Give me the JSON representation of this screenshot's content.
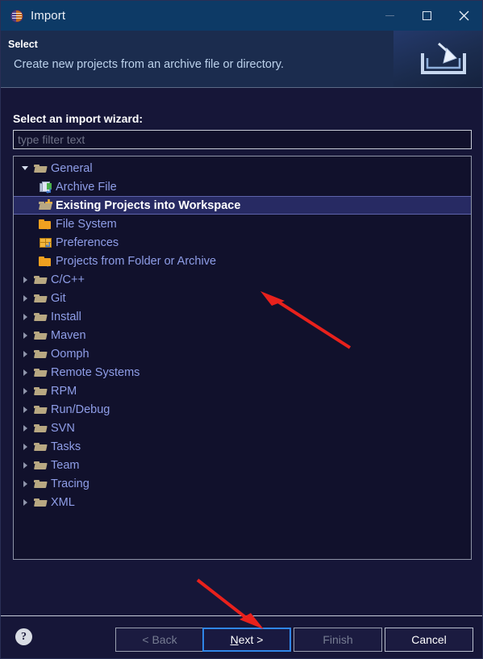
{
  "window": {
    "title": "Import",
    "app_icon": "eclipse-globe-icon",
    "controls": {
      "minimize": "minimize-icon",
      "maximize": "maximize-icon",
      "close": "close-icon"
    },
    "titlebar_color": "#0d3a66",
    "body_color": "#161638"
  },
  "header": {
    "title": "Select",
    "description": "Create new projects from an archive file or directory.",
    "graphic": "import-tray-icon",
    "banner_color": "#1b2c4e"
  },
  "main": {
    "wizard_label": "Select an import wizard:",
    "filter": {
      "placeholder": "type filter text",
      "value": ""
    },
    "tree": [
      {
        "label": "General",
        "icon": "folder-open-icon",
        "level": 0,
        "expanded": true,
        "twisty": "expanded",
        "selected": false
      },
      {
        "label": "Archive File",
        "icon": "archive-file-icon",
        "level": 1,
        "twisty": "none",
        "selected": false
      },
      {
        "label": "Existing Projects into Workspace",
        "icon": "folder-import-icon",
        "level": 1,
        "twisty": "none",
        "selected": true
      },
      {
        "label": "File System",
        "icon": "folder-filesystem-icon",
        "level": 1,
        "twisty": "none",
        "selected": false
      },
      {
        "label": "Preferences",
        "icon": "preferences-grid-icon",
        "level": 1,
        "twisty": "none",
        "selected": false
      },
      {
        "label": "Projects from Folder or Archive",
        "icon": "folder-filesystem-icon",
        "level": 1,
        "twisty": "none",
        "selected": false
      },
      {
        "label": "C/C++",
        "icon": "folder-open-icon",
        "level": 0,
        "twisty": "collapsed",
        "selected": false
      },
      {
        "label": "Git",
        "icon": "folder-open-icon",
        "level": 0,
        "twisty": "collapsed",
        "selected": false
      },
      {
        "label": "Install",
        "icon": "folder-open-icon",
        "level": 0,
        "twisty": "collapsed",
        "selected": false
      },
      {
        "label": "Maven",
        "icon": "folder-open-icon",
        "level": 0,
        "twisty": "collapsed",
        "selected": false
      },
      {
        "label": "Oomph",
        "icon": "folder-open-icon",
        "level": 0,
        "twisty": "collapsed",
        "selected": false
      },
      {
        "label": "Remote Systems",
        "icon": "folder-open-icon",
        "level": 0,
        "twisty": "collapsed",
        "selected": false
      },
      {
        "label": "RPM",
        "icon": "folder-open-icon",
        "level": 0,
        "twisty": "collapsed",
        "selected": false
      },
      {
        "label": "Run/Debug",
        "icon": "folder-open-icon",
        "level": 0,
        "twisty": "collapsed",
        "selected": false
      },
      {
        "label": "SVN",
        "icon": "folder-open-icon",
        "level": 0,
        "twisty": "collapsed",
        "selected": false
      },
      {
        "label": "Tasks",
        "icon": "folder-open-icon",
        "level": 0,
        "twisty": "collapsed",
        "selected": false
      },
      {
        "label": "Team",
        "icon": "folder-open-icon",
        "level": 0,
        "twisty": "collapsed",
        "selected": false
      },
      {
        "label": "Tracing",
        "icon": "folder-open-icon",
        "level": 0,
        "twisty": "collapsed",
        "selected": false
      },
      {
        "label": "XML",
        "icon": "folder-open-icon",
        "level": 0,
        "twisty": "collapsed",
        "selected": false
      }
    ]
  },
  "footer": {
    "help": "?",
    "buttons": {
      "back": {
        "label": "< Back",
        "enabled": false,
        "focused": false
      },
      "next": {
        "label": "Next >",
        "enabled": true,
        "focused": true,
        "mnemonic": "N"
      },
      "finish": {
        "label": "Finish",
        "enabled": false,
        "focused": false
      },
      "cancel": {
        "label": "Cancel",
        "enabled": true,
        "focused": false
      }
    }
  },
  "annotations": {
    "color": "#e8211c",
    "arrows": [
      {
        "name": "arrow-to-selected-row",
        "points_to": "Existing Projects into Workspace"
      },
      {
        "name": "arrow-to-next-button",
        "points_to": "Next >"
      }
    ]
  }
}
